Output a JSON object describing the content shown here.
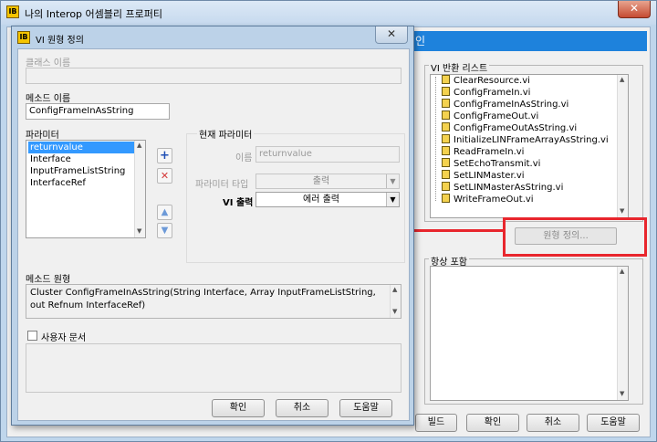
{
  "back_window": {
    "title": "나의 Interop 어셈블리 프로퍼티",
    "app_icon_text": "IB",
    "close_glyph": "✕",
    "banner_text": "인",
    "vi_return_list_label": "VI 반환 리스트",
    "vi_items": [
      "ClearResource.vi",
      "ConfigFrameIn.vi",
      "ConfigFrameInAsString.vi",
      "ConfigFrameOut.vi",
      "ConfigFrameOutAsString.vi",
      "InitializeLINFrameArrayAsString.vi",
      "ReadFrameIn.vi",
      "SetEchoTransmit.vi",
      "SetLINMaster.vi",
      "SetLINMasterAsString.vi",
      "WriteFrameOut.vi"
    ],
    "define_button": "원형 정의...",
    "always_include_label": "항상 포함",
    "buttons": {
      "build": "빌드",
      "ok": "확인",
      "cancel": "취소",
      "help": "도움말"
    }
  },
  "dialog": {
    "title": "VI 원형 정의",
    "app_icon_text": "IB",
    "close_glyph": "✕",
    "class_name_label": "클래스 이름",
    "class_name_value": "",
    "method_name_label": "메소드 이름",
    "method_name_value": "ConfigFrameInAsString",
    "parameters_label": "파라미터",
    "parameters": [
      "returnvalue",
      "Interface",
      "InputFrameListString",
      "InterfaceRef"
    ],
    "current_param_label": "현재 파라미터",
    "name_label": "이름",
    "name_value": "returnvalue",
    "param_type_label": "파라미터 타입",
    "param_type_value": "출력",
    "vi_output_label": "VI 출력",
    "vi_output_value": "에러 출력",
    "method_prototype_label": "메소드 원형",
    "method_prototype_value": "Cluster ConfigFrameInAsString(String Interface, Array InputFrameListString, out Refnum InterfaceRef)",
    "user_doc_label": "사용자 문서",
    "user_doc_checked": false,
    "buttons": {
      "ok": "확인",
      "cancel": "취소",
      "help": "도움말"
    },
    "add_glyph": "+",
    "remove_glyph": "✕",
    "up_glyph": "▲",
    "down_glyph": "▼"
  }
}
